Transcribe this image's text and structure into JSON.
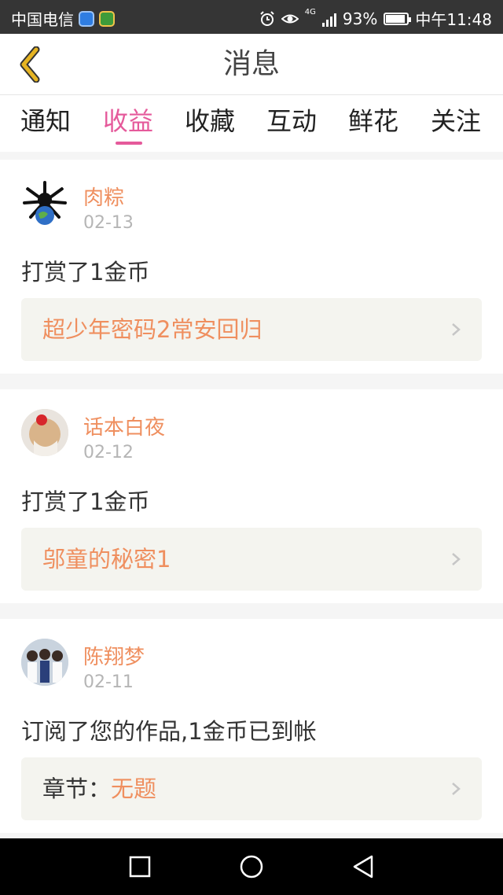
{
  "status_bar": {
    "carrier": "中国电信",
    "network": "4G",
    "battery": "93%",
    "battery_level": 0.93,
    "time": "中午11:48"
  },
  "header": {
    "title": "消息",
    "back_icon": "chevron-left-icon",
    "accent": "#e6b422"
  },
  "tabs": [
    {
      "label": "通知",
      "active": false
    },
    {
      "label": "收益",
      "active": true
    },
    {
      "label": "收藏",
      "active": false
    },
    {
      "label": "互动",
      "active": false
    },
    {
      "label": "鲜花",
      "active": false
    },
    {
      "label": "关注",
      "active": false
    }
  ],
  "colors": {
    "active_tab": "#e55a9b",
    "username": "#ef8f5f",
    "date": "#b5b5b5",
    "link_box_bg": "#f4f4ef"
  },
  "messages": [
    {
      "username": "肉粽",
      "date": "02-13",
      "action": "打赏了1金币",
      "link_prefix": "",
      "link_text": "超少年密码2常安回归"
    },
    {
      "username": "话本白夜",
      "date": "02-12",
      "action": "打赏了1金币",
      "link_prefix": "",
      "link_text": "邬童的秘密1"
    },
    {
      "username": "陈翔梦",
      "date": "02-11",
      "action": "订阅了您的作品,1金币已到帐",
      "link_prefix": "章节：",
      "link_text": "无题"
    }
  ],
  "nav_bar": {
    "icons": [
      "recent-apps-icon",
      "home-icon",
      "back-icon"
    ]
  }
}
